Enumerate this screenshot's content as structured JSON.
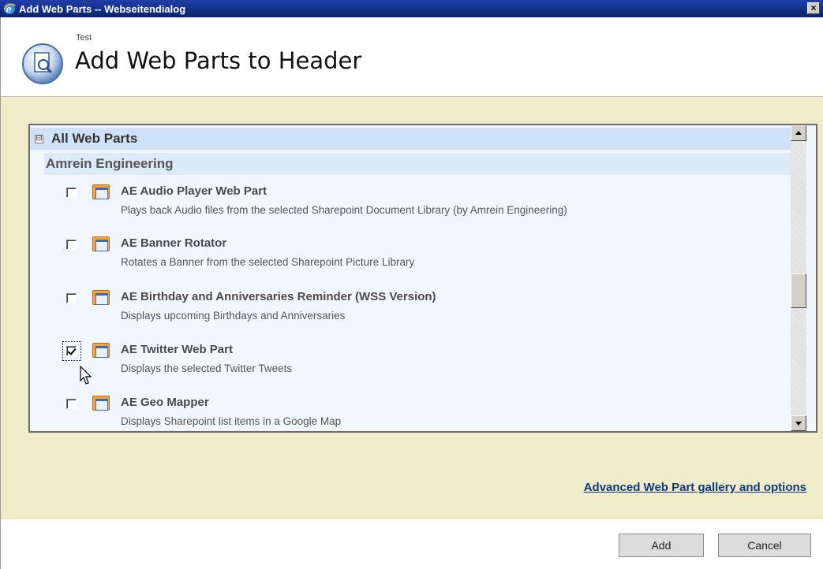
{
  "window": {
    "title": "Add Web Parts -- Webseitendialog",
    "close_label": "×"
  },
  "header": {
    "breadcrumb": "Test",
    "title": "Add Web Parts to Header"
  },
  "list": {
    "group_label": "All Web Parts",
    "collapse_symbol": "⊟",
    "category_label": "Amrein Engineering",
    "items": [
      {
        "title": "AE Audio Player Web Part",
        "description": "Plays back Audio files from the selected Sharepoint Document Library (by Amrein Engineering)",
        "checked": false
      },
      {
        "title": "AE Banner Rotator",
        "description": "Rotates a Banner from the selected Sharepoint Picture Library",
        "checked": false
      },
      {
        "title": "AE Birthday and Anniversaries Reminder (WSS Version)",
        "description": "Displays upcoming Birthdays and Anniversaries",
        "checked": false
      },
      {
        "title": "AE Twitter Web Part",
        "description": "Displays the selected Twitter Tweets",
        "checked": true
      },
      {
        "title": "AE Geo Mapper",
        "description": "Displays Sharepoint list items in a Google Map",
        "checked": false
      }
    ]
  },
  "advanced_link": "Advanced Web Part gallery and options",
  "footer": {
    "add_label": "Add",
    "cancel_label": "Cancel"
  },
  "colors": {
    "titlebar": "#0a246a",
    "panel": "#f0ebc8",
    "group_header": "#d0e2f7",
    "link": "#0a3a7a"
  }
}
